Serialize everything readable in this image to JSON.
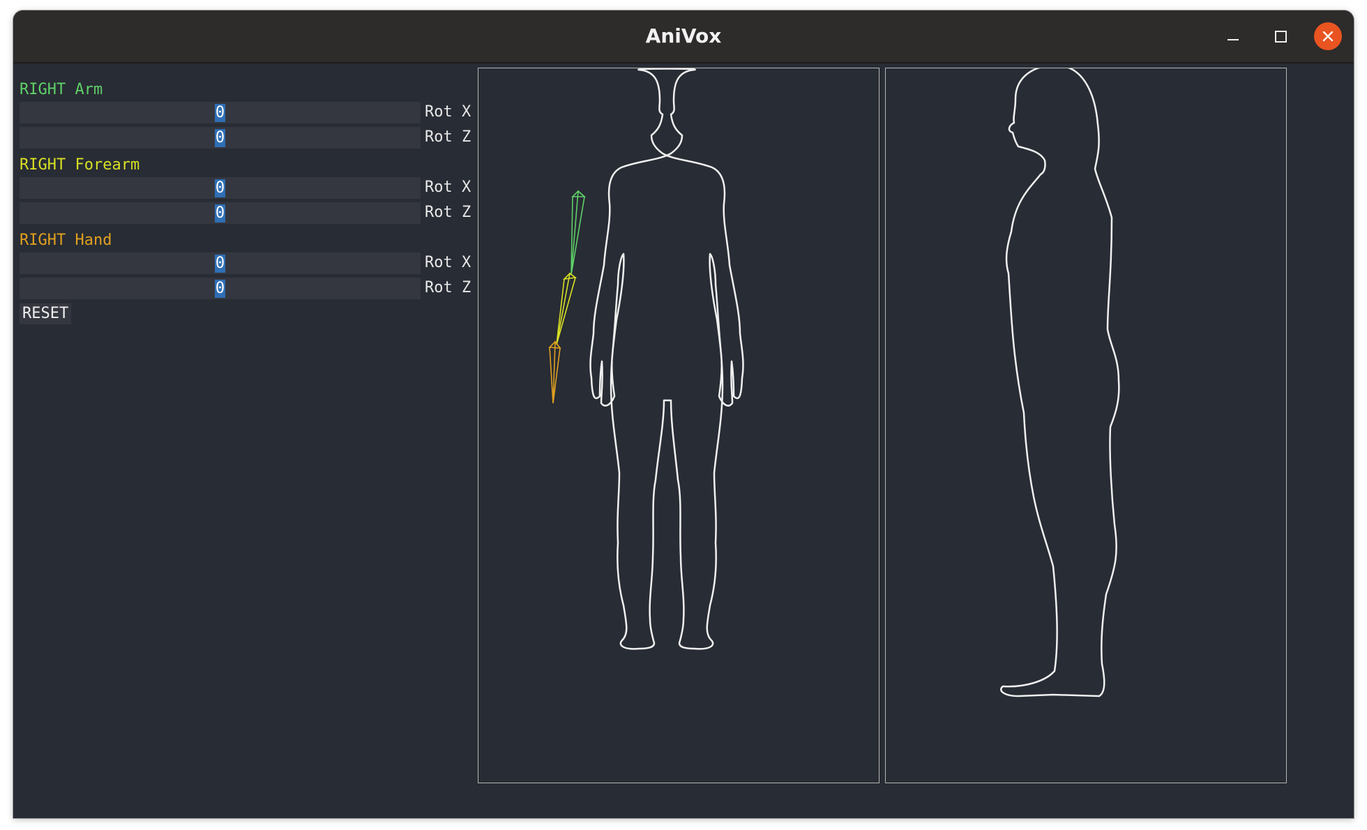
{
  "window": {
    "title": "AniVox",
    "controls": [
      "minimize-icon",
      "maximize-icon",
      "close-icon"
    ],
    "accent": "#e95420"
  },
  "panel": {
    "groups": [
      {
        "label": "RIGHT Arm",
        "color": "#5fd068",
        "fields": [
          {
            "value": "0",
            "label": "Rot X"
          },
          {
            "value": "0",
            "label": "Rot Z"
          }
        ]
      },
      {
        "label": "RIGHT Forearm",
        "color": "#d8e024",
        "fields": [
          {
            "value": "0",
            "label": "Rot X"
          },
          {
            "value": "0",
            "label": "Rot Z"
          }
        ]
      },
      {
        "label": "RIGHT Hand",
        "color": "#e0a020",
        "fields": [
          {
            "value": "0",
            "label": "Rot X"
          },
          {
            "value": "0",
            "label": "Rot Z"
          }
        ]
      }
    ],
    "reset_label": "RESET"
  },
  "viewports": {
    "front": {
      "view": "front",
      "icon": "human-front-silhouette"
    },
    "side": {
      "view": "side",
      "icon": "human-side-silhouette"
    }
  }
}
